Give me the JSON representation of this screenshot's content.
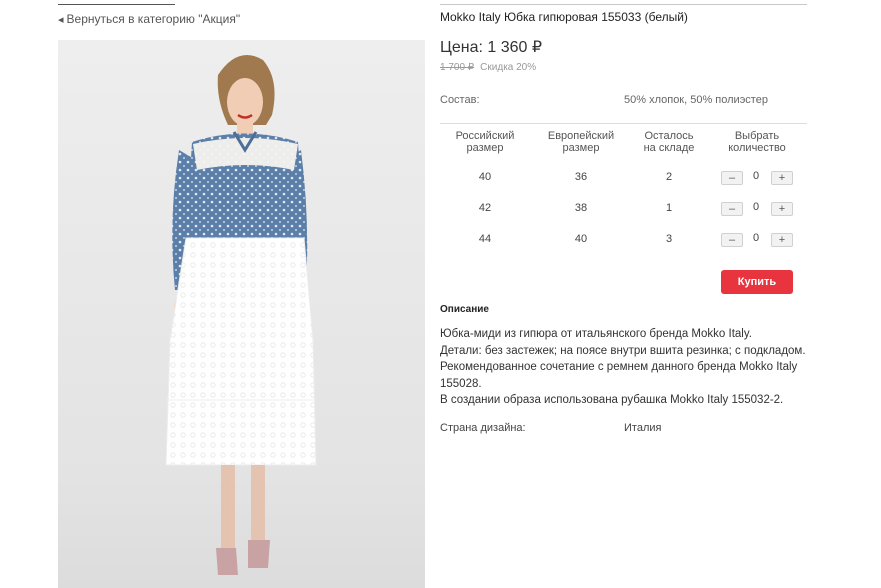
{
  "nav": {
    "back_link": "Вернуться в категорию \"Акция\""
  },
  "product": {
    "title": "Mokko Italy Юбка гипюровая 155033 (белый)",
    "price": "Цена: 1 360 ₽",
    "old_price": "1 700 ₽",
    "discount": "Скидка 20%",
    "composition_label": "Состав:",
    "composition_value": "50% хлопок, 50% полиэстер"
  },
  "size_table": {
    "headers": [
      [
        "Российский",
        "размер"
      ],
      [
        "Европейский",
        "размер"
      ],
      [
        "Осталось",
        "на складе"
      ],
      [
        "Выбрать",
        "количество"
      ]
    ],
    "rows": [
      {
        "ru": "40",
        "eu": "36",
        "stock": "2",
        "qty": "0"
      },
      {
        "ru": "42",
        "eu": "38",
        "stock": "1",
        "qty": "0"
      },
      {
        "ru": "44",
        "eu": "40",
        "stock": "3",
        "qty": "0"
      }
    ],
    "minus": "–",
    "plus": "+"
  },
  "buy_label": "Купить",
  "description": {
    "title": "Описание",
    "lines": [
      "Юбка-миди из гипюра от итальянского бренда Mokko Italy.",
      "Детали: без застежек; на поясе внутри вшита резинка; с подкладом.  Рекомендованное сочетание с ремнем данного бренда Mokko Italy 155028.",
      "В создании образа использована рубашка Mokko Italy 155032-2."
    ]
  },
  "country": {
    "label": "Страна дизайна:",
    "value": "Италия"
  },
  "colors": {
    "accent": "#e8343f",
    "shirt": "#5b7fa8",
    "skirt": "#ffffff"
  },
  "icons": {
    "back": "arrow-left-icon"
  }
}
